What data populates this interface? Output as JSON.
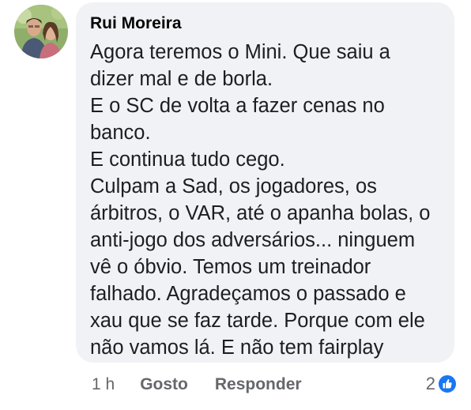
{
  "comment": {
    "author": "Rui Moreira",
    "lines": [
      "Agora teremos o Mini. Que saiu a",
      "dizer mal e de borla.",
      "E o SC de volta a fazer cenas no",
      "banco.",
      "E continua tudo cego.",
      "Culpam a Sad, os jogadores, os",
      "árbitros, o VAR, até o apanha bolas, o",
      "anti-jogo dos adversários... ninguem",
      "vê o óbvio. Temos um treinador",
      "falhado. Agradeçamos o passado e",
      "xau que se faz tarde. Porque com ele",
      "não vamos lá. E não tem fairplay"
    ]
  },
  "actions": {
    "time": "1 h",
    "like_label": "Gosto",
    "reply_label": "Responder"
  },
  "reactions": {
    "count": "2",
    "icon": "like-thumb-icon",
    "color": "#1877f2"
  }
}
